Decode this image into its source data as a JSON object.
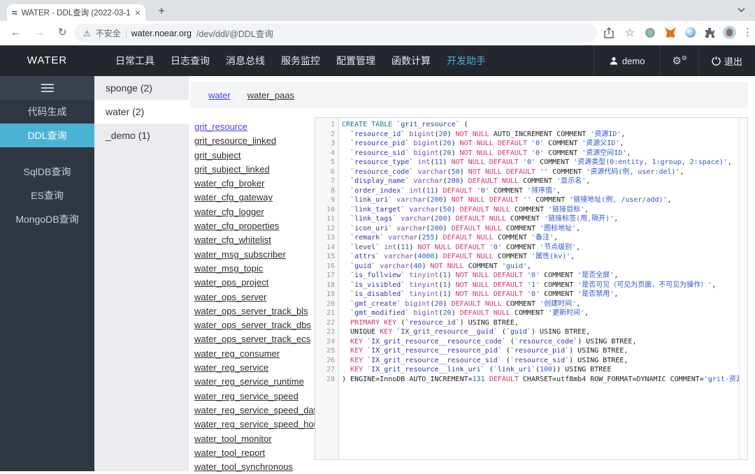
{
  "colors": {
    "accent": "#4cb2d4",
    "link": "#4443e4",
    "syn_teal": "#17818c",
    "syn_magenta": "#d6336c",
    "syn_purple": "#7048b6",
    "syn_ident": "#2639a8",
    "syn_literal": "#2b55cc"
  },
  "icons": {
    "favicon_wave": "≈",
    "tab_close": "×",
    "new_tab": "+",
    "back": "←",
    "forward": "→",
    "reload": "↻",
    "warning": "⚠",
    "star": "☆",
    "kebab": "⋮",
    "gear_big": "⚙",
    "gear_small": "⚙"
  },
  "browser": {
    "tab": {
      "title": "WATER - DDL查询 (2022-03-1"
    },
    "address": {
      "security_label": "不安全",
      "domain": "water.noear.org",
      "path": "/dev/ddl/@DDL查询"
    }
  },
  "navbar": {
    "brand": "WATER",
    "items": [
      {
        "label": "日常工具",
        "active": false
      },
      {
        "label": "日志查询",
        "active": false
      },
      {
        "label": "消息总线",
        "active": false
      },
      {
        "label": "服务监控",
        "active": false
      },
      {
        "label": "配置管理",
        "active": false
      },
      {
        "label": "函数计算",
        "active": false
      },
      {
        "label": "开发助手",
        "active": true
      }
    ],
    "user": "demo",
    "logout_label": "退出"
  },
  "sidebar": {
    "items": [
      {
        "label": "代码生成",
        "active": false,
        "gap": false
      },
      {
        "label": "DDL查询",
        "active": true,
        "gap": false
      },
      {
        "label": "SqlDB查询",
        "active": false,
        "gap": true
      },
      {
        "label": "ES查询",
        "active": false,
        "gap": false
      },
      {
        "label": "MongoDB查询",
        "active": false,
        "gap": false
      }
    ]
  },
  "db_list": {
    "items": [
      {
        "label": "sponge (2)",
        "active": false
      },
      {
        "label": "water (2)",
        "active": true
      },
      {
        "label": "_demo (1)",
        "active": false
      }
    ]
  },
  "main": {
    "schema_tabs": [
      {
        "label": "water",
        "active": true
      },
      {
        "label": "water_paas",
        "active": false
      }
    ],
    "tables": [
      {
        "label": "grit_resource",
        "active": true
      },
      {
        "label": "grit_resource_linked",
        "active": false
      },
      {
        "label": "grit_subject",
        "active": false
      },
      {
        "label": "grit_subject_linked",
        "active": false
      },
      {
        "label": "water_cfg_broker",
        "active": false
      },
      {
        "label": "water_cfg_gateway",
        "active": false
      },
      {
        "label": "water_cfg_logger",
        "active": false
      },
      {
        "label": "water_cfg_properties",
        "active": false
      },
      {
        "label": "water_cfg_whitelist",
        "active": false
      },
      {
        "label": "water_msg_subscriber",
        "active": false
      },
      {
        "label": "water_msg_topic",
        "active": false
      },
      {
        "label": "water_ops_project",
        "active": false
      },
      {
        "label": "water_ops_server",
        "active": false
      },
      {
        "label": "water_ops_server_track_bls",
        "active": false
      },
      {
        "label": "water_ops_server_track_dbs",
        "active": false
      },
      {
        "label": "water_ops_server_track_ecs",
        "active": false
      },
      {
        "label": "water_reg_consumer",
        "active": false
      },
      {
        "label": "water_reg_service",
        "active": false
      },
      {
        "label": "water_reg_service_runtime",
        "active": false
      },
      {
        "label": "water_reg_service_speed",
        "active": false
      },
      {
        "label": "water_reg_service_speed_date",
        "active": false
      },
      {
        "label": "water_reg_service_speed_hour",
        "active": false
      },
      {
        "label": "water_tool_monitor",
        "active": false
      },
      {
        "label": "water_tool_report",
        "active": false
      },
      {
        "label": "water_tool_synchronous",
        "active": false
      }
    ],
    "editor": {
      "language": "sql",
      "lines": [
        "CREATE TABLE `grit_resource` (",
        "  `resource_id` bigint(20) NOT NULL AUTO_INCREMENT COMMENT '资源ID',",
        "  `resource_pid` bigint(20) NOT NULL DEFAULT '0' COMMENT '资源父ID',",
        "  `resource_sid` bigint(20) NOT NULL DEFAULT '0' COMMENT '资源空间ID',",
        "  `resource_type` int(11) NOT NULL DEFAULT '0' COMMENT '资源类型(0:entity, 1:group, 2:space)',",
        "  `resource_code` varchar(50) NOT NULL DEFAULT '' COMMENT '资源代码(例, user:del)',",
        "  `display_name` varchar(200) DEFAULT NULL COMMENT '显示名',",
        "  `order_index` int(11) DEFAULT '0' COMMENT '排序值',",
        "  `link_uri` varchar(200) NOT NULL DEFAULT '' COMMENT '链接地址(例, /user/add)',",
        "  `link_target` varchar(50) DEFAULT NULL COMMENT '链接目标',",
        "  `link_tags` varchar(200) DEFAULT NULL COMMENT '链接标签(用,隔开)',",
        "  `icon_uri` varchar(200) DEFAULT NULL COMMENT '图标地址',",
        "  `remark` varchar(255) DEFAULT NULL COMMENT '备注',",
        "  `level` int(11) NOT NULL DEFAULT '0' COMMENT '节点级别',",
        "  `attrs` varchar(4000) DEFAULT NULL COMMENT '属性(kv)',",
        "  `guid` varchar(40) NOT NULL COMMENT 'guid',",
        "  `is_fullview` tinyint(1) NOT NULL DEFAULT '0' COMMENT '是否全屏',",
        "  `is_visibled` tinyint(1) NOT NULL DEFAULT '1' COMMENT '是否可见（可见为页面，不可见为操作）',",
        "  `is_disabled` tinyint(1) NOT NULL DEFAULT '0' COMMENT '是否禁用',",
        "  `gmt_create` bigint(20) DEFAULT NULL COMMENT '创建时间',",
        "  `gmt_modified` bigint(20) DEFAULT NULL COMMENT '更新时间',",
        "  PRIMARY KEY (`resource_id`) USING BTREE,",
        "  UNIQUE KEY `IX_grit_resource__guid` (`guid`) USING BTREE,",
        "  KEY `IX_grit_resource__resource_code` (`resource_code`) USING BTREE,",
        "  KEY `IX_grit_resource__resource_pid` (`resource_pid`) USING BTREE,",
        "  KEY `IX_grit_resource__resource_sid` (`resource_sid`) USING BTREE,",
        "  KEY `IX_grit_resource__link_uri` (`link_uri`(100)) USING BTREE",
        ") ENGINE=InnoDB AUTO_INCREMENT=131 DEFAULT CHARSET=utf8mb4 ROW_FORMAT=DYNAMIC COMMENT='grit-资源"
      ]
    }
  }
}
